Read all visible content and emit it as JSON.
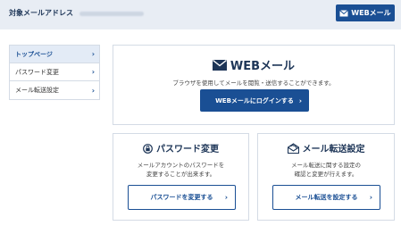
{
  "topbar": {
    "address_label": "対象メールアドレス",
    "address_value": "",
    "web_button_label": "WEBメール",
    "web_button_icon": "mail-icon"
  },
  "sidebar": {
    "items": [
      {
        "label": "トップページ",
        "active": true
      },
      {
        "label": "パスワード変更",
        "active": false
      },
      {
        "label": "メール転送設定",
        "active": false
      }
    ]
  },
  "webmail_card": {
    "icon": "mail-icon",
    "title": "WEBメール",
    "description": "ブラウザを使用してメールを閲覧・送信することができます。",
    "button_label": "WEBメールにログインする"
  },
  "password_card": {
    "icon": "lock-icon",
    "title": "パスワード変更",
    "description_lines": [
      "メールアカウントのパスワードを",
      "変更することが出来ます。"
    ],
    "button_label": "パスワードを変更する"
  },
  "forward_card": {
    "icon": "mail-forward-icon",
    "title": "メール転送設定",
    "description_lines": [
      "メール転送に関する設定の",
      "確認と変更が行えます。"
    ],
    "button_label": "メール転送を設定する"
  },
  "colors": {
    "primary": "#1a4f94",
    "topbar_bg": "#e8edf4",
    "active_bg": "#e3ebf6",
    "border": "#d4dbe5",
    "title": "#1d3557"
  }
}
